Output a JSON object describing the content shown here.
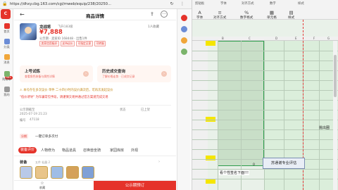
{
  "browser": {
    "url": "https://dhxy.cbg.163.com/cgi/mweb/equip/238/20250...",
    "controls": [
      "↻",
      "⋮",
      "✕"
    ]
  },
  "site_sidebar": {
    "items": [
      {
        "label": "首页",
        "color": "#e5332a"
      },
      {
        "label": "分类",
        "color": "#6b8cd6"
      },
      {
        "label": "消息",
        "color": "#f0a63a"
      },
      {
        "label": "购物车",
        "color": "#7bb46b"
      },
      {
        "label": "我的",
        "color": "#999999"
      }
    ],
    "badge": "99+",
    "logo": "C"
  },
  "page": {
    "title": "商品详情",
    "back_icon": "←",
    "share_icon": "⇪",
    "more_icon": "⋯"
  },
  "product": {
    "nickname": "龙战将",
    "server": "飞升183级",
    "price": "¥7,888",
    "seller_line": "公示期 · 卖家ID 168448 · 出售1件",
    "on_sale": "1人收藏",
    "tags": [
      "卖家信用极好",
      "支持议价",
      "可指定买家",
      "可转服"
    ]
  },
  "cards": [
    {
      "title": "上号试炼",
      "subtitle": "查看角色装备与属性详情"
    },
    {
      "title": "历史成交查询",
      "subtitle": "了解价格走势 · 已成交记录"
    }
  ],
  "notices": {
    "line1": "⚠ 本号存在多次议价 单件 二十四小时内议价满次后，可再次发起议价",
    "line2": "\"低价诱导\" 为诈骗常见手段，请谨慎交易并通过官方渠道完成交易"
  },
  "meta": {
    "publish_label": "公示期截至",
    "publish_value": "2025-07-19 21:23",
    "id_label": "编号",
    "id_value": "47118",
    "right_label": "状态",
    "right_value": "已上架"
  },
  "installment": {
    "badge": "分期",
    "text": "一键订单多次付"
  },
  "tabs": [
    "装备评价",
    "人物修为",
    "物品道具",
    "召唤兽坐骑",
    "家园库房",
    "外观"
  ],
  "equipment": {
    "title": "装备",
    "subtitle": "五件 仙器 2",
    "more": "›",
    "colors": [
      "#b9c9e8",
      "#e9c58a",
      "#9fbde6",
      "#d4a15a",
      "#7fa0d6"
    ]
  },
  "bottom": {
    "favorite": "收藏",
    "favorite_icon": "☆",
    "buy": "公示期预订"
  },
  "extension": {
    "colors": [
      "#e5332a",
      "#6b8cd6",
      "#f0a63a",
      "#7bb46b"
    ]
  },
  "excel": {
    "top_labels": [
      "剪贴板",
      "字体",
      "对齐方式",
      "数字",
      "样式"
    ],
    "buttons": [
      {
        "icon": "A",
        "label": "字体"
      },
      {
        "icon": "≡",
        "label": "对齐方式"
      },
      {
        "icon": "%",
        "label": "数字格式"
      },
      {
        "icon": "▦",
        "label": "单元格"
      },
      {
        "icon": "▤",
        "label": "样式"
      }
    ],
    "columns": [
      "B",
      "C",
      "D",
      "E",
      "F",
      "G"
    ],
    "zero": "0",
    "caption": "看个性签名下面!!!",
    "eval_box": "苏通谢专业评估",
    "jump": "挑出圈"
  }
}
